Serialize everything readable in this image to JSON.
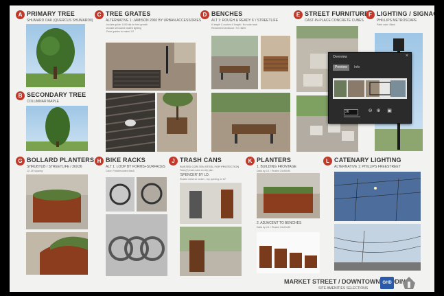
{
  "sections": {
    "a": {
      "letter": "A",
      "title": "Primary Tree",
      "sub": "Shumard Oak (Quercus Shumardii)"
    },
    "b": {
      "letter": "B",
      "title": "Secondary Tree",
      "sub": "Columnar Maple"
    },
    "c": {
      "letter": "C",
      "title": "Tree Grates",
      "sub": "Alternative 1: Jamison 2000 by Urban Accessories",
      "notes": [
        "-Include guide: 1000 dia for tree growth",
        "-Include shrouded rotated lighting",
        "-Pave grades to match 1/2"
      ]
    },
    "d": {
      "letter": "D",
      "title": "Benches",
      "sub": "Alt 1: Rough & Ready 6' / Streetlife",
      "notes": [
        "6' length & custom 4' length / No solar back",
        "Reclaimed hardwood / TO: $300"
      ]
    },
    "e": {
      "letter": "E",
      "title": "Street Furniture",
      "sub": "Cast-in-place concrete cubes"
    },
    "f": {
      "letter": "F",
      "title": "Lighting / Signage",
      "sub": "Phillips Metroscape",
      "notes": [
        "Paint color: Black"
      ]
    },
    "g": {
      "letter": "G",
      "title": "Bollard Planters",
      "sub": "Shrubtub / Streetlife / 36x36",
      "notes": [
        "12'-18' spacing"
      ]
    },
    "h": {
      "letter": "H",
      "title": "Bike Racks",
      "sub": "Alt 1: Loop by Forms+Surfaces",
      "notes": [
        "Color: Powdercoated black"
      ]
    },
    "j": {
      "letter": "J",
      "title": "Trash Cans",
      "sub": "Rusted cor-ten steel for protection",
      "notes": [
        "Total (2) trash cans on city plan",
        "'Spencer' by LD.",
        "Rusted metal w/ rocker - top opening w/ 12\""
      ]
    },
    "k": {
      "letter": "K",
      "title": "Planters",
      "sub": "1. Building Frontage",
      "notes": [
        "Dalia by LD. / Rusted 24x48x30",
        "2. Adjacent to benches",
        "Dalia by LD. / Rusted 24x24x30"
      ]
    },
    "l": {
      "letter": "L",
      "title": "Catenary Lighting",
      "sub": "Alternative 1: Phillips Freestreet"
    }
  },
  "footer": {
    "title": "Market Street / Downtown Redding",
    "sub": "Site amenities selections",
    "logo": "GHD"
  },
  "overview": {
    "title": "Overview",
    "tab_preview": "Preview",
    "tab_info": "Info",
    "zoom": "26",
    "close": "×"
  },
  "colors": {
    "badge": "#c0392b",
    "panel": "#2b2b2b"
  }
}
